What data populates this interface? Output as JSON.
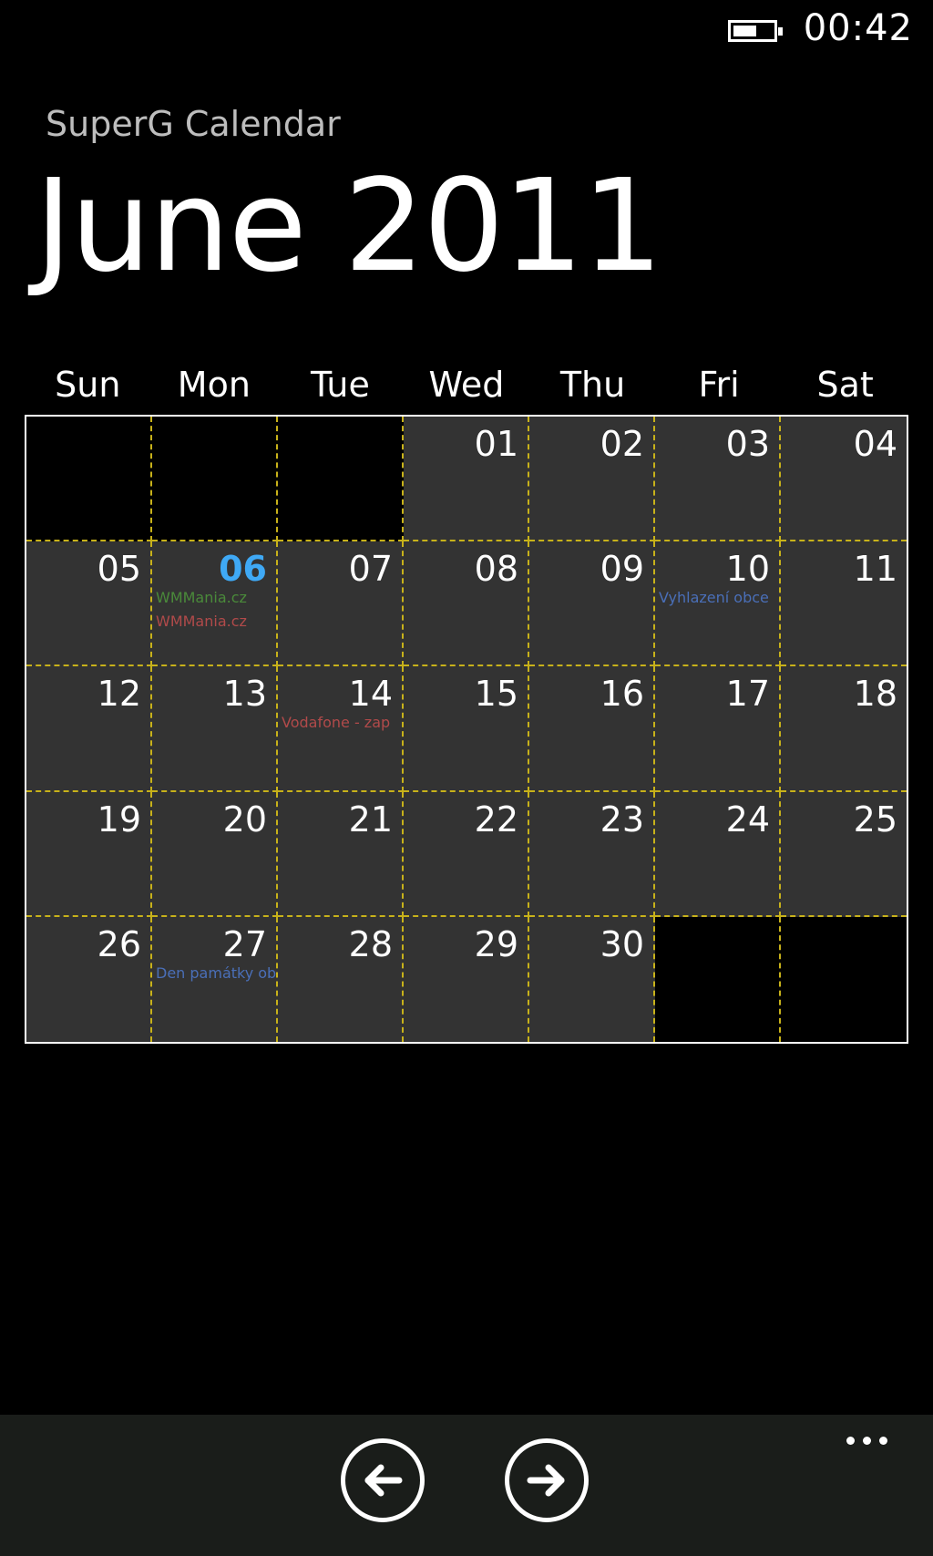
{
  "status_bar": {
    "time": "00:42",
    "battery_level": 0.6
  },
  "app_title": "SuperG Calendar",
  "month_title": "June 2011",
  "weekdays": [
    "Sun",
    "Mon",
    "Tue",
    "Wed",
    "Thu",
    "Fri",
    "Sat"
  ],
  "days": [
    {
      "label": ""
    },
    {
      "label": ""
    },
    {
      "label": ""
    },
    {
      "label": "01"
    },
    {
      "label": "02"
    },
    {
      "label": "03"
    },
    {
      "label": "04"
    },
    {
      "label": "05"
    },
    {
      "label": "06",
      "today": true,
      "events": [
        {
          "text": "WMMania.cz",
          "color": "#4a8a3a"
        },
        {
          "text": "WMMania.cz",
          "color": "#b14a4a"
        }
      ]
    },
    {
      "label": "07"
    },
    {
      "label": "08"
    },
    {
      "label": "09"
    },
    {
      "label": "10",
      "events": [
        {
          "text": "Vyhlazení obce",
          "color": "#4a6fb8"
        }
      ]
    },
    {
      "label": "11"
    },
    {
      "label": "12"
    },
    {
      "label": "13"
    },
    {
      "label": "14",
      "events": [
        {
          "text": "Vodafone - zap",
          "color": "#b14a4a"
        }
      ]
    },
    {
      "label": "15"
    },
    {
      "label": "16"
    },
    {
      "label": "17"
    },
    {
      "label": "18"
    },
    {
      "label": "19"
    },
    {
      "label": "20"
    },
    {
      "label": "21"
    },
    {
      "label": "22"
    },
    {
      "label": "23"
    },
    {
      "label": "24"
    },
    {
      "label": "25"
    },
    {
      "label": "26"
    },
    {
      "label": "27",
      "events": [
        {
          "text": "Den památky ob",
          "color": "#4a6fb8"
        }
      ]
    },
    {
      "label": "28"
    },
    {
      "label": "29"
    },
    {
      "label": "30"
    },
    {
      "label": ""
    },
    {
      "label": ""
    }
  ],
  "app_bar": {
    "prev_icon": "arrow-left-icon",
    "next_icon": "arrow-right-icon",
    "more_icon": "ellipsis-icon"
  },
  "colors": {
    "today": "#3fa9f5",
    "cell_bg": "#333333",
    "grid_dash": "#c8b21a",
    "app_bar_bg": "#1a1d1a"
  }
}
